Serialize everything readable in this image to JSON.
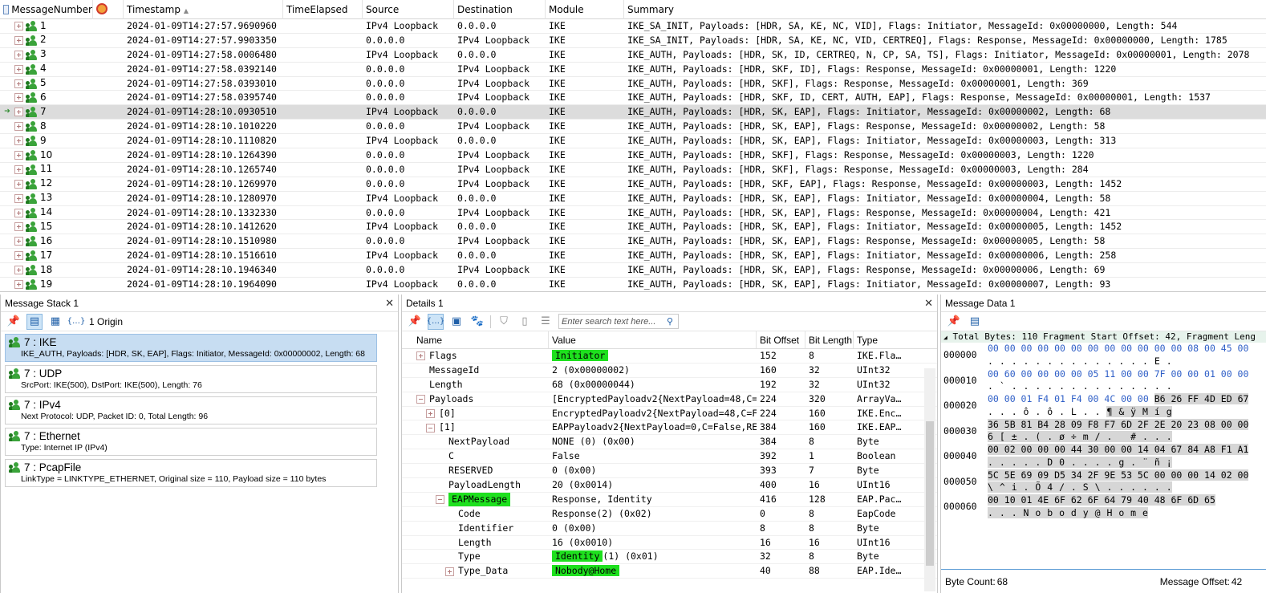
{
  "grid": {
    "columns": [
      "MessageNumber",
      "",
      "Timestamp",
      "TimeElapsed",
      "Source",
      "Destination",
      "Module",
      "Summary"
    ],
    "rows": [
      {
        "num": "1",
        "ts": "2024-01-09T14:27:57.9690960",
        "te": "",
        "src": "IPv4 Loopback",
        "dst": "0.0.0.0",
        "mod": "IKE",
        "sum": "IKE_SA_INIT, Payloads: [HDR, SA, KE, NC, VID], Flags: Initiator, MessageId: 0x00000000, Length: 544"
      },
      {
        "num": "2",
        "ts": "2024-01-09T14:27:57.9903350",
        "te": "",
        "src": "0.0.0.0",
        "dst": "IPv4 Loopback",
        "mod": "IKE",
        "sum": "IKE_SA_INIT, Payloads: [HDR, SA, KE, NC, VID, CERTREQ], Flags: Response, MessageId: 0x00000000, Length: 1785"
      },
      {
        "num": "3",
        "ts": "2024-01-09T14:27:58.0006480",
        "te": "",
        "src": "IPv4 Loopback",
        "dst": "0.0.0.0",
        "mod": "IKE",
        "sum": "IKE_AUTH, Payloads: [HDR, SK, ID, CERTREQ, N, CP, SA, TS], Flags: Initiator, MessageId: 0x00000001, Length: 2078"
      },
      {
        "num": "4",
        "ts": "2024-01-09T14:27:58.0392140",
        "te": "",
        "src": "0.0.0.0",
        "dst": "IPv4 Loopback",
        "mod": "IKE",
        "sum": "IKE_AUTH, Payloads: [HDR, SKF, ID], Flags: Response, MessageId: 0x00000001, Length: 1220"
      },
      {
        "num": "5",
        "ts": "2024-01-09T14:27:58.0393010",
        "te": "",
        "src": "0.0.0.0",
        "dst": "IPv4 Loopback",
        "mod": "IKE",
        "sum": "IKE_AUTH, Payloads: [HDR, SKF], Flags: Response, MessageId: 0x00000001, Length: 369"
      },
      {
        "num": "6",
        "ts": "2024-01-09T14:27:58.0395740",
        "te": "",
        "src": "0.0.0.0",
        "dst": "IPv4 Loopback",
        "mod": "IKE",
        "sum": "IKE_AUTH, Payloads: [HDR, SKF, ID, CERT, AUTH, EAP], Flags: Response, MessageId: 0x00000001, Length: 1537"
      },
      {
        "num": "7",
        "ts": "2024-01-09T14:28:10.0930510",
        "te": "",
        "src": "IPv4 Loopback",
        "dst": "0.0.0.0",
        "mod": "IKE",
        "sum": "IKE_AUTH, Payloads: [HDR, SK, EAP], Flags: Initiator, MessageId: 0x00000002, Length: 68",
        "selected": true
      },
      {
        "num": "8",
        "ts": "2024-01-09T14:28:10.1010220",
        "te": "",
        "src": "0.0.0.0",
        "dst": "IPv4 Loopback",
        "mod": "IKE",
        "sum": "IKE_AUTH, Payloads: [HDR, SK, EAP], Flags: Response, MessageId: 0x00000002, Length: 58"
      },
      {
        "num": "9",
        "ts": "2024-01-09T14:28:10.1110820",
        "te": "",
        "src": "IPv4 Loopback",
        "dst": "0.0.0.0",
        "mod": "IKE",
        "sum": "IKE_AUTH, Payloads: [HDR, SK, EAP], Flags: Initiator, MessageId: 0x00000003, Length: 313"
      },
      {
        "num": "10",
        "ts": "2024-01-09T14:28:10.1264390",
        "te": "",
        "src": "0.0.0.0",
        "dst": "IPv4 Loopback",
        "mod": "IKE",
        "sum": "IKE_AUTH, Payloads: [HDR, SKF], Flags: Response, MessageId: 0x00000003, Length: 1220"
      },
      {
        "num": "11",
        "ts": "2024-01-09T14:28:10.1265740",
        "te": "",
        "src": "0.0.0.0",
        "dst": "IPv4 Loopback",
        "mod": "IKE",
        "sum": "IKE_AUTH, Payloads: [HDR, SKF], Flags: Response, MessageId: 0x00000003, Length: 284"
      },
      {
        "num": "12",
        "ts": "2024-01-09T14:28:10.1269970",
        "te": "",
        "src": "0.0.0.0",
        "dst": "IPv4 Loopback",
        "mod": "IKE",
        "sum": "IKE_AUTH, Payloads: [HDR, SKF, EAP], Flags: Response, MessageId: 0x00000003, Length: 1452"
      },
      {
        "num": "13",
        "ts": "2024-01-09T14:28:10.1280970",
        "te": "",
        "src": "IPv4 Loopback",
        "dst": "0.0.0.0",
        "mod": "IKE",
        "sum": "IKE_AUTH, Payloads: [HDR, SK, EAP], Flags: Initiator, MessageId: 0x00000004, Length: 58"
      },
      {
        "num": "14",
        "ts": "2024-01-09T14:28:10.1332330",
        "te": "",
        "src": "0.0.0.0",
        "dst": "IPv4 Loopback",
        "mod": "IKE",
        "sum": "IKE_AUTH, Payloads: [HDR, SK, EAP], Flags: Response, MessageId: 0x00000004, Length: 421"
      },
      {
        "num": "15",
        "ts": "2024-01-09T14:28:10.1412620",
        "te": "",
        "src": "IPv4 Loopback",
        "dst": "0.0.0.0",
        "mod": "IKE",
        "sum": "IKE_AUTH, Payloads: [HDR, SK, EAP], Flags: Initiator, MessageId: 0x00000005, Length: 1452"
      },
      {
        "num": "16",
        "ts": "2024-01-09T14:28:10.1510980",
        "te": "",
        "src": "0.0.0.0",
        "dst": "IPv4 Loopback",
        "mod": "IKE",
        "sum": "IKE_AUTH, Payloads: [HDR, SK, EAP], Flags: Response, MessageId: 0x00000005, Length: 58"
      },
      {
        "num": "17",
        "ts": "2024-01-09T14:28:10.1516610",
        "te": "",
        "src": "IPv4 Loopback",
        "dst": "0.0.0.0",
        "mod": "IKE",
        "sum": "IKE_AUTH, Payloads: [HDR, SK, EAP], Flags: Initiator, MessageId: 0x00000006, Length: 258"
      },
      {
        "num": "18",
        "ts": "2024-01-09T14:28:10.1946340",
        "te": "",
        "src": "0.0.0.0",
        "dst": "IPv4 Loopback",
        "mod": "IKE",
        "sum": "IKE_AUTH, Payloads: [HDR, SK, EAP], Flags: Response, MessageId: 0x00000006, Length: 69"
      },
      {
        "num": "19",
        "ts": "2024-01-09T14:28:10.1964090",
        "te": "",
        "src": "IPv4 Loopback",
        "dst": "0.0.0.0",
        "mod": "IKE",
        "sum": "IKE_AUTH, Payloads: [HDR, SK, EAP], Flags: Initiator, MessageId: 0x00000007, Length: 93"
      }
    ]
  },
  "stack": {
    "title": "Message Stack 1",
    "origin_label": "1 Origin",
    "items": [
      {
        "head": "7 : IKE",
        "sub": "IKE_AUTH, Payloads: [HDR, SK, EAP], Flags: Initiator, MessageId: 0x00000002, Length: 68",
        "selected": true
      },
      {
        "head": "7 : UDP",
        "sub": "SrcPort: IKE(500), DstPort: IKE(500), Length: 76"
      },
      {
        "head": "7 : IPv4",
        "sub": "Next Protocol: UDP, Packet ID: 0, Total Length: 96"
      },
      {
        "head": "7 : Ethernet",
        "sub": "Type: Internet IP (IPv4)"
      },
      {
        "head": "7 : PcapFile",
        "sub": "LinkType = LINKTYPE_ETHERNET, Original size = 110, Payload size = 110 bytes"
      }
    ]
  },
  "details": {
    "title": "Details 1",
    "search_placeholder": "Enter search text here...",
    "columns": [
      "Name",
      "Value",
      "Bit Offset",
      "Bit Length",
      "Type"
    ],
    "rows": [
      {
        "indent": 0,
        "expander": "plus",
        "name": "Flags",
        "value": "Initiator",
        "value_hl": true,
        "bo": "152",
        "bl": "8",
        "type": "IKE.Fla…"
      },
      {
        "indent": 0,
        "expander": "",
        "name": "MessageId",
        "value": "2 (0x00000002)",
        "bo": "160",
        "bl": "32",
        "type": "UInt32"
      },
      {
        "indent": 0,
        "expander": "",
        "name": "Length",
        "value": "68 (0x00000044)",
        "bo": "192",
        "bl": "32",
        "type": "UInt32"
      },
      {
        "indent": 0,
        "expander": "minus",
        "name": "Payloads",
        "value": "[EncryptedPayloadv2{NextPayload=48,C=…",
        "bo": "224",
        "bl": "320",
        "type": "ArrayVa…"
      },
      {
        "indent": 1,
        "expander": "plus",
        "name": "[0]",
        "value": "EncryptedPayloadv2{NextPayload=48,C=F…",
        "bo": "224",
        "bl": "160",
        "type": "IKE.Enc…"
      },
      {
        "indent": 1,
        "expander": "minus",
        "name": "[1]",
        "value": "EAPPayloadv2{NextPayload=0,C=False,RE…",
        "bo": "384",
        "bl": "160",
        "type": "IKE.EAP…"
      },
      {
        "indent": 2,
        "expander": "",
        "name": "NextPayload",
        "value": "NONE (0) (0x00)",
        "bo": "384",
        "bl": "8",
        "type": "Byte"
      },
      {
        "indent": 2,
        "expander": "",
        "name": "C",
        "value": "False",
        "bo": "392",
        "bl": "1",
        "type": "Boolean"
      },
      {
        "indent": 2,
        "expander": "",
        "name": "RESERVED",
        "value": "0 (0x00)",
        "bo": "393",
        "bl": "7",
        "type": "Byte"
      },
      {
        "indent": 2,
        "expander": "",
        "name": "PayloadLength",
        "value": "20 (0x0014)",
        "bo": "400",
        "bl": "16",
        "type": "UInt16"
      },
      {
        "indent": 2,
        "expander": "minus",
        "name": "EAPMessage",
        "name_hl": true,
        "value": "Response, Identity",
        "bo": "416",
        "bl": "128",
        "type": "EAP.Pac…"
      },
      {
        "indent": 3,
        "expander": "",
        "name": "Code",
        "value": "Response(2) (0x02)",
        "bo": "0",
        "bl": "8",
        "type": "EapCode"
      },
      {
        "indent": 3,
        "expander": "",
        "name": "Identifier",
        "value": "0 (0x00)",
        "bo": "8",
        "bl": "8",
        "type": "Byte"
      },
      {
        "indent": 3,
        "expander": "",
        "name": "Length",
        "value": "16 (0x0010)",
        "bo": "16",
        "bl": "16",
        "type": "UInt16"
      },
      {
        "indent": 3,
        "expander": "",
        "name": "Type",
        "value_hl_part": "Identity",
        "value_rest": "(1) (0x01)",
        "bo": "32",
        "bl": "8",
        "type": "Byte"
      },
      {
        "indent": 3,
        "expander": "plus",
        "name": "Type_Data",
        "value": "Nobody@Home",
        "value_hl": true,
        "bo": "40",
        "bl": "88",
        "type": "EAP.Ide…"
      }
    ]
  },
  "msgdata": {
    "title": "Message Data 1",
    "top_line": "Total Bytes: 110 Fragment Start Offset: 42, Fragment Leng",
    "rows": [
      {
        "off": "000000",
        "hex_pre": "00 00 00 00 00 00 00 00 00 00 00 00 08 00 45 00",
        "hex_sel": "",
        "asc_pre": ". . . . . . . . . . . . . . E .",
        "asc_sel": ""
      },
      {
        "off": "000010",
        "hex_pre": "00 60 00 00 00 00 05 11 00 00 7F 00 00 01 00 00",
        "hex_sel": "",
        "asc_pre": ". ` . . . . . . . . . . . . . .",
        "asc_sel": ""
      },
      {
        "off": "000020",
        "hex_pre": "00 00 01 F4 01 F4 00 4C 00 00 ",
        "hex_sel": "B6 26 FF 4D ED 67",
        "asc_pre": ". . . ô . ô . L . . ",
        "asc_sel": "¶ & ÿ M í g"
      },
      {
        "off": "000030",
        "hex_pre": "",
        "hex_sel": "36 5B 81 B4 28 09 F8 F7 6D 2F 2E 20 23 08 00 00",
        "asc_pre": "",
        "asc_sel": "6 [ ± . ( . ø ÷ m / .   # . . ."
      },
      {
        "off": "000040",
        "hex_pre": "",
        "hex_sel": "00 02 00 00 00 44 30 00 00 14 04 67 84 A8 F1 A1",
        "asc_pre": "",
        "asc_sel": ". . . . . D 0 . . . . g . ¨ ñ ¡"
      },
      {
        "off": "000050",
        "hex_pre": "",
        "hex_sel": "5C 5E 69 09 D5 34 2F 9E 53 5C 00 00 00 14 02 00",
        "asc_pre": "",
        "asc_sel": "\\ ^ i . Õ 4 / . S \\ . . . . . ."
      },
      {
        "off": "000060",
        "hex_pre": "",
        "hex_sel": "00 10 01 4E 6F 62 6F 64 79 40 48 6F 6D 65",
        "asc_pre": "",
        "asc_sel": ". . . N o b o d y @ H o m e"
      }
    ],
    "byte_count_label": "Byte Count:",
    "byte_count": "68",
    "msg_offset_label": "Message Offset:",
    "msg_offset": "42"
  },
  "colors": {
    "highlight": "#1ee01e",
    "selected_row": "#dcdcdc",
    "stack_selected": "#c7ddf2",
    "hex_blue": "#2f5fc7"
  }
}
